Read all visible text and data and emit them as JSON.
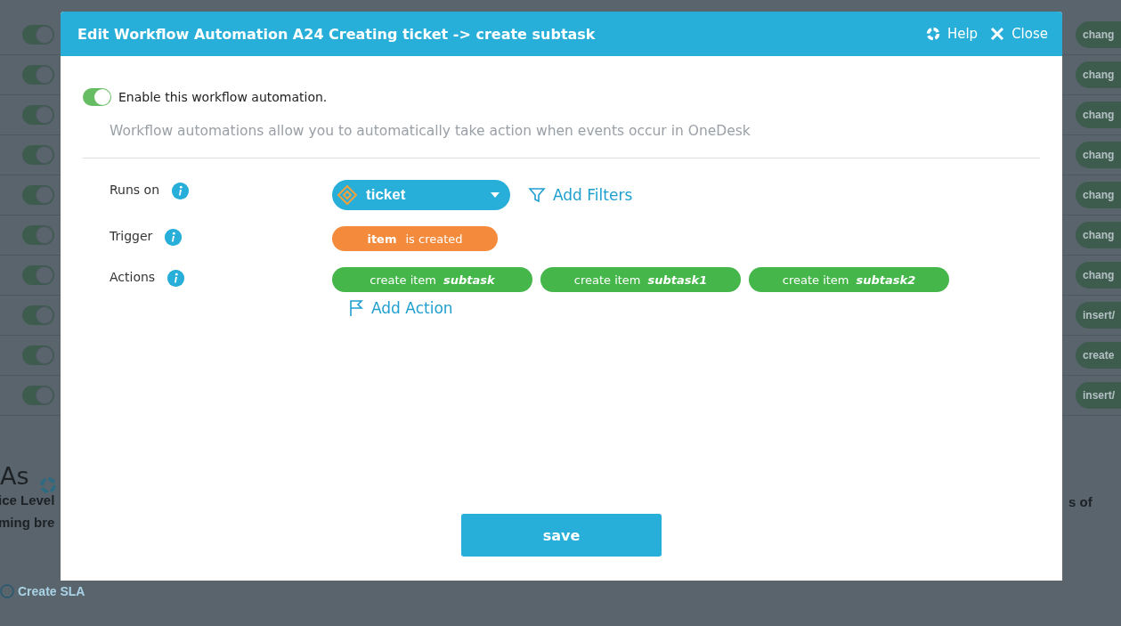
{
  "background": {
    "rows": [
      {
        "enabled": true,
        "action": "chang"
      },
      {
        "enabled": true,
        "action": "chang"
      },
      {
        "enabled": true,
        "action": "chang"
      },
      {
        "enabled": true,
        "action": "chang"
      },
      {
        "enabled": true,
        "action": "chang"
      },
      {
        "enabled": true,
        "action": "chang"
      },
      {
        "enabled": true,
        "action": "chang"
      },
      {
        "enabled": true,
        "action": "insert/"
      },
      {
        "enabled": true,
        "action": "create"
      },
      {
        "enabled": true,
        "action": "insert/"
      }
    ],
    "section_title": "As",
    "description_lines": [
      "ice Level",
      "ming bre"
    ],
    "description_right": "s of",
    "create_link": "Create SLA"
  },
  "dialog": {
    "title": "Edit Workflow Automation A24 Creating ticket -> create subtask",
    "help": "Help",
    "close": "Close",
    "enable_toggle": {
      "label": "Enable this workflow automation.",
      "on": true
    },
    "intro": "Workflow automations allow you to automatically take action when events occur in OneDesk",
    "runs_on": {
      "label": "Runs on",
      "value": "ticket",
      "add_filters": "Add Filters"
    },
    "trigger": {
      "label": "Trigger",
      "item": "item",
      "event": "is created"
    },
    "actions": {
      "label": "Actions",
      "items": [
        {
          "verb": "create item",
          "target": "subtask"
        },
        {
          "verb": "create item",
          "target": "subtask1"
        },
        {
          "verb": "create item",
          "target": "subtask2"
        }
      ],
      "add_action": "Add Action"
    },
    "save": "save"
  }
}
